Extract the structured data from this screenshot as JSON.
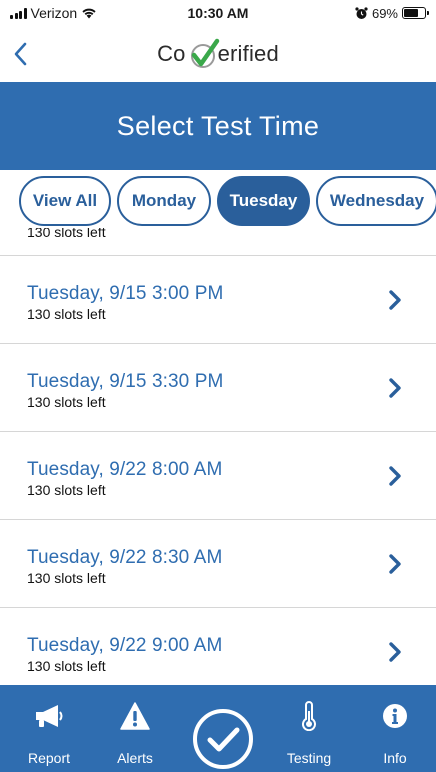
{
  "status_bar": {
    "carrier": "Verizon",
    "time": "10:30 AM",
    "battery": "69%",
    "battery_level": 0.69
  },
  "nav": {
    "back_icon": "chevron-left-icon",
    "logo_prefix": "Co",
    "logo_suffix": "erified",
    "logo_mark_icon": "check-v-icon"
  },
  "header": {
    "title": "Select Test Time"
  },
  "tabs": [
    {
      "label": "View All",
      "active": false
    },
    {
      "label": "Monday",
      "active": false
    },
    {
      "label": "Tuesday",
      "active": true
    },
    {
      "label": "Wednesday",
      "active": false
    }
  ],
  "list": {
    "partial_slots": "130 slots left",
    "rows": [
      {
        "time": "Tuesday, 9/15 3:00  PM",
        "slots": "130 slots left"
      },
      {
        "time": "Tuesday, 9/15 3:30  PM",
        "slots": "130 slots left"
      },
      {
        "time": "Tuesday, 9/22 8:00 AM",
        "slots": "130 slots left"
      },
      {
        "time": "Tuesday, 9/22 8:30 AM",
        "slots": "130 slots left"
      },
      {
        "time": "Tuesday, 9/22 9:00 AM",
        "slots": "130 slots left"
      }
    ]
  },
  "bottom_nav": {
    "report": {
      "label": "Report",
      "icon": "megaphone-icon"
    },
    "alerts": {
      "label": "Alerts",
      "icon": "warning-icon"
    },
    "center": {
      "icon": "check-circle-icon"
    },
    "testing": {
      "label": "Testing",
      "icon": "thermometer-icon"
    },
    "info": {
      "label": "Info",
      "icon": "info-icon"
    }
  },
  "colors": {
    "primary": "#2f6db0",
    "tab_border": "#2a5f9b",
    "check_green": "#3aa84a",
    "divider": "#d6d6d6"
  }
}
